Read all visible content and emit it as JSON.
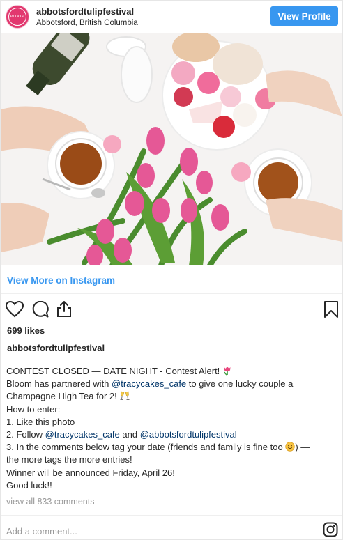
{
  "header": {
    "username": "abbotsfordtulipfestival",
    "location": "Abbotsford, British Columbia",
    "avatar_text": "BLOOM",
    "view_profile_label": "View Profile"
  },
  "photo": {
    "description_icon": "tea-tulips-photo"
  },
  "view_more_label": "View More on Instagram",
  "actions": {
    "like_icon": "heart-icon",
    "comment_icon": "comment-icon",
    "share_icon": "share-icon",
    "save_icon": "bookmark-icon"
  },
  "likes": "699 likes",
  "author": "abbotsfordtulipfestival",
  "caption": {
    "l1": "CONTEST CLOSED — DATE NIGHT - Contest Alert!",
    "l2a": "Bloom has partnered with ",
    "l2_mention": "@tracycakes_cafe",
    "l2b": " to give one lucky couple a",
    "l3": "Champagne High Tea for 2!",
    "l4": "How to enter:",
    "l5": "1. Like this photo",
    "l6a": "2. Follow ",
    "l6_mention1": "@tracycakes_cafe",
    "l6b": " and ",
    "l6_mention2": "@abbotsfordtulipfestival",
    "l7a": "3. In the comments below tag your date (friends and family is fine too ",
    "l7b": ") —",
    "l8": "the more tags the more entries!",
    "l9": "Winner will be announced Friday, April 26!",
    "l10": "Good luck!!"
  },
  "view_all_comments": "view all 833 comments",
  "add_comment_placeholder": "Add a comment...",
  "colors": {
    "accent": "#3897f0",
    "mention": "#003569",
    "muted": "#999999",
    "avatar_bg": "#e2386f"
  }
}
